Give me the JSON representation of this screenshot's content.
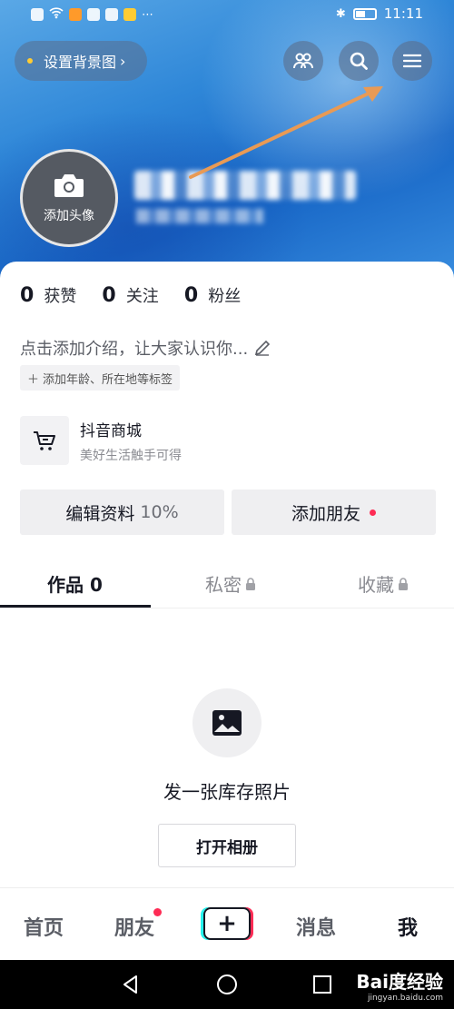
{
  "statusbar": {
    "time": "11:11"
  },
  "header": {
    "bg_button": "设置背景图",
    "avatar_label": "添加头像"
  },
  "stats": [
    {
      "num": "0",
      "label": "获赞"
    },
    {
      "num": "0",
      "label": "关注"
    },
    {
      "num": "0",
      "label": "粉丝"
    }
  ],
  "intro": "点击添加介绍，让大家认识你...",
  "tag_button": "添加年龄、所在地等标签",
  "shop": {
    "title": "抖音商城",
    "subtitle": "美好生活触手可得"
  },
  "actions": {
    "edit": "编辑资料",
    "edit_pct": "10%",
    "add_friend": "添加朋友"
  },
  "tabs": {
    "works": "作品 0",
    "private": "私密",
    "favorites": "收藏"
  },
  "empty": {
    "text": "发一张库存照片",
    "button": "打开相册"
  },
  "bottom_nav": {
    "home": "首页",
    "friends": "朋友",
    "plus": "+",
    "messages": "消息",
    "me": "我"
  },
  "watermark": {
    "brand": "Bai度经验",
    "url": "jingyan.baidu.com"
  },
  "colors": {
    "accent": "#fe2c55",
    "header_blue": "#2f87d8",
    "annotation_arrow": "#e99a54"
  }
}
